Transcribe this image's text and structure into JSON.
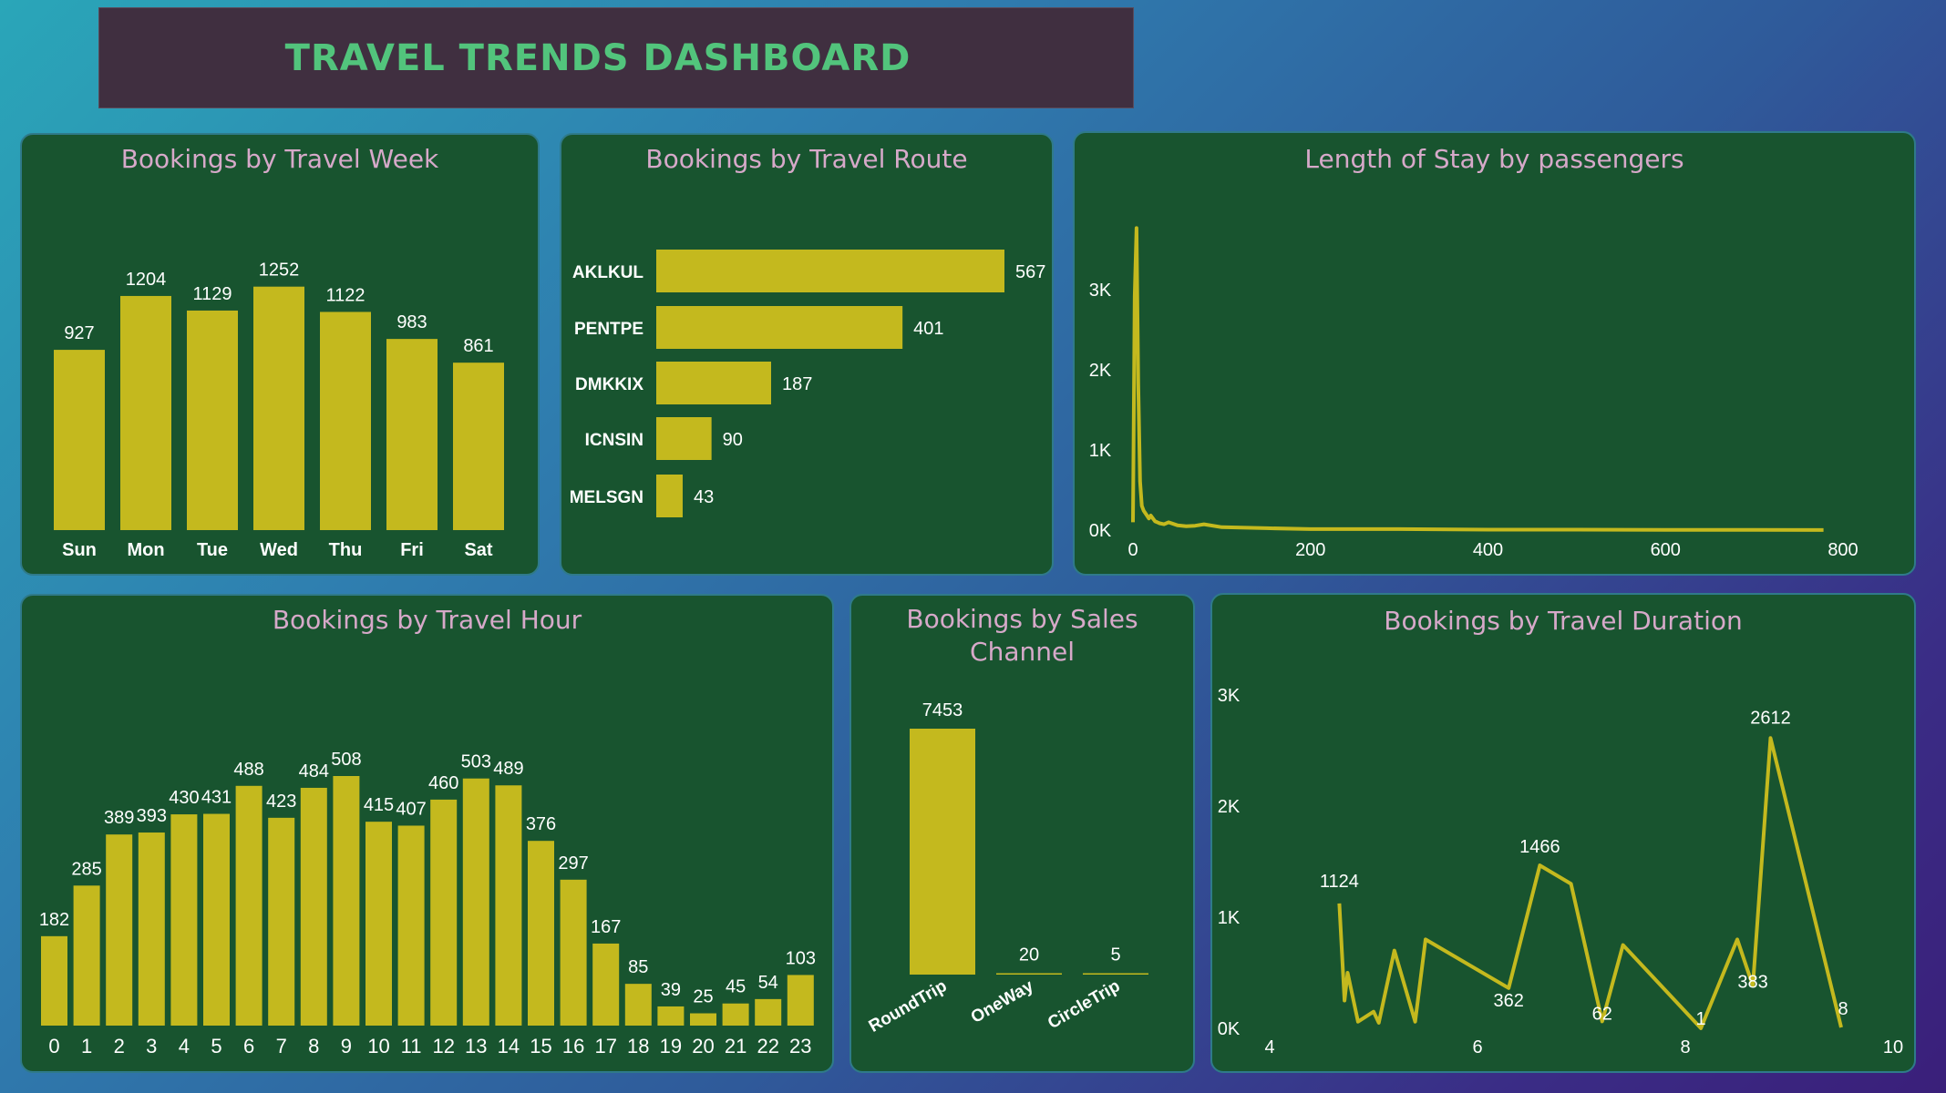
{
  "dashboard": {
    "title": "TRAVEL TRENDS DASHBOARD"
  },
  "colors": {
    "bar": "#c4b91e",
    "panel": "#18542f",
    "title_text": "#52c47c",
    "panel_title": "#d6a9c9"
  },
  "chart_data": [
    {
      "id": "week",
      "type": "bar",
      "title": "Bookings by Travel Week",
      "categories": [
        "Sun",
        "Mon",
        "Tue",
        "Wed",
        "Thu",
        "Fri",
        "Sat"
      ],
      "values": [
        927,
        1204,
        1129,
        1252,
        1122,
        983,
        861
      ],
      "ylim": [
        0,
        1300
      ]
    },
    {
      "id": "route",
      "type": "bar",
      "orientation": "horizontal",
      "title": "Bookings by  Travel Route",
      "categories": [
        "AKLKUL",
        "PENTPE",
        "DMKKIX",
        "ICNSIN",
        "MELSGN"
      ],
      "values": [
        567,
        401,
        187,
        90,
        43
      ],
      "xlim": [
        0,
        567
      ]
    },
    {
      "id": "stay",
      "type": "line",
      "title": "Length of Stay by passengers",
      "x": [
        0,
        2,
        4,
        6,
        8,
        10,
        12,
        15,
        18,
        20,
        25,
        30,
        35,
        40,
        50,
        60,
        70,
        80,
        100,
        150,
        200,
        300,
        400,
        500,
        600,
        700,
        778
      ],
      "y": [
        80,
        2400,
        3100,
        1500,
        500,
        250,
        200,
        160,
        120,
        150,
        90,
        70,
        60,
        80,
        50,
        40,
        45,
        60,
        30,
        20,
        10,
        10,
        5,
        5,
        3,
        2,
        1
      ],
      "xticks": [
        "0",
        "200",
        "400",
        "600",
        "800"
      ],
      "yticks": [
        "0K",
        "1K",
        "2K",
        "3K"
      ],
      "xlim": [
        0,
        800
      ],
      "ylim": [
        0,
        3300
      ]
    },
    {
      "id": "hour",
      "type": "bar",
      "title": "Bookings by Travel Hour",
      "categories": [
        "0",
        "1",
        "2",
        "3",
        "4",
        "5",
        "6",
        "7",
        "8",
        "9",
        "10",
        "11",
        "12",
        "13",
        "14",
        "15",
        "16",
        "17",
        "18",
        "19",
        "20",
        "21",
        "22",
        "23"
      ],
      "values": [
        182,
        285,
        389,
        393,
        430,
        431,
        488,
        423,
        484,
        508,
        415,
        407,
        460,
        503,
        489,
        376,
        297,
        167,
        85,
        39,
        25,
        45,
        54,
        103
      ],
      "ylim": [
        0,
        520
      ]
    },
    {
      "id": "channel",
      "type": "bar",
      "title": "Bookings by Sales Channel",
      "categories": [
        "RoundTrip",
        "OneWay",
        "CircleTrip"
      ],
      "values": [
        7453,
        20,
        5
      ],
      "ylim": [
        0,
        7453
      ]
    },
    {
      "id": "duration",
      "type": "line",
      "title": "Bookings by Travel Duration",
      "x": [
        4.67,
        4.72,
        4.75,
        4.85,
        5.0,
        5.05,
        5.2,
        5.4,
        5.5,
        6.3,
        6.6,
        6.9,
        7.2,
        7.4,
        8.15,
        8.5,
        8.65,
        8.82,
        9.5
      ],
      "y": [
        1124,
        250,
        500,
        60,
        150,
        50,
        700,
        60,
        800,
        362,
        1466,
        1300,
        62,
        750,
        1,
        800,
        383,
        2612,
        8
      ],
      "labels": [
        {
          "x": 4.67,
          "y": 1124,
          "text": "1124"
        },
        {
          "x": 6.3,
          "y": 362,
          "text": "362"
        },
        {
          "x": 6.6,
          "y": 1466,
          "text": "1466"
        },
        {
          "x": 7.2,
          "y": 62,
          "text": "62"
        },
        {
          "x": 8.15,
          "y": 1,
          "text": "1"
        },
        {
          "x": 8.65,
          "y": 383,
          "text": "383"
        },
        {
          "x": 8.82,
          "y": 2612,
          "text": "2612"
        },
        {
          "x": 9.5,
          "y": 8,
          "text": "8"
        }
      ],
      "xticks": [
        "4",
        "6",
        "8",
        "10"
      ],
      "yticks": [
        "0K",
        "1K",
        "2K",
        "3K"
      ],
      "xlim": [
        4,
        10
      ],
      "ylim": [
        0,
        3000
      ]
    }
  ]
}
